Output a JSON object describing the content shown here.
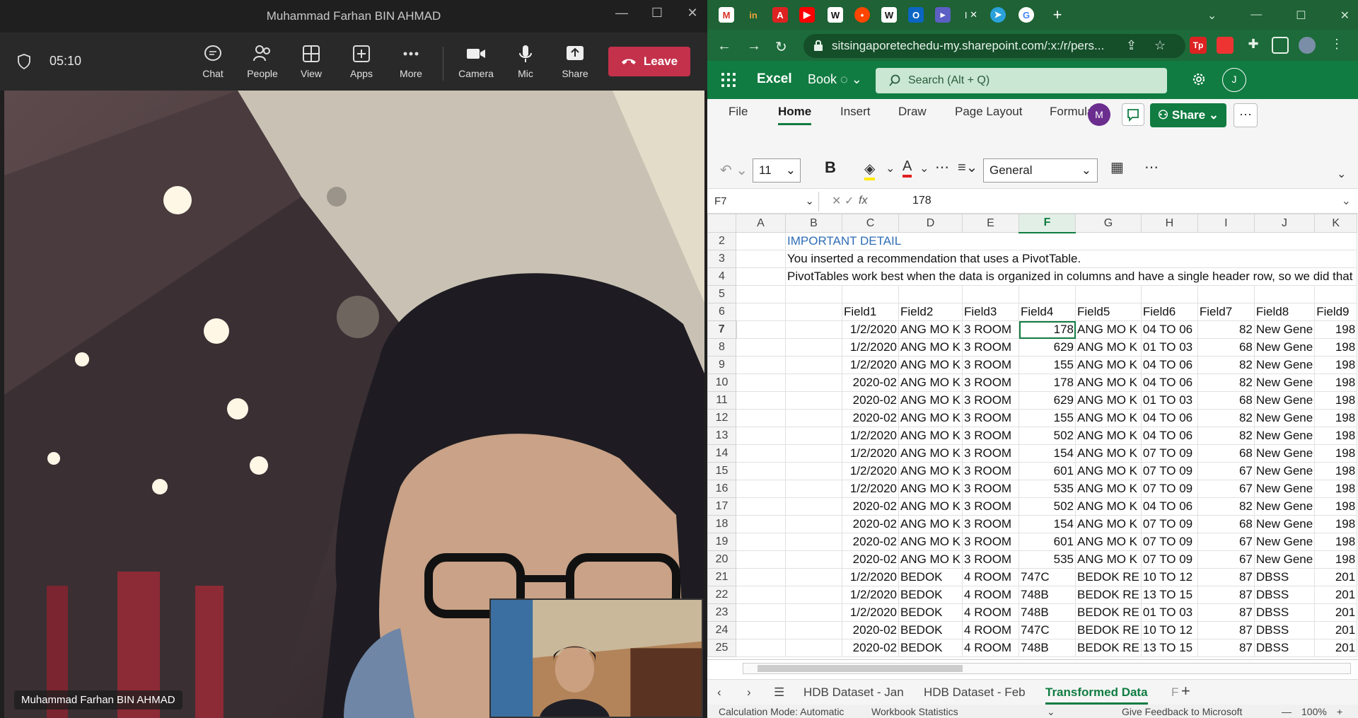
{
  "teams": {
    "title": "Muhammad Farhan BIN AHMAD",
    "timer": "05:10",
    "buttons": [
      "Chat",
      "People",
      "View",
      "Apps",
      "More",
      "Camera",
      "Mic",
      "Share"
    ],
    "leave_label": "Leave",
    "participant_name": "Muhammad Farhan BIN AHMAD",
    "leave_color": "#c4314b"
  },
  "browser": {
    "url": "sitsingaporetechedu-my.sharepoint.com/:x:/r/pers...",
    "active_tab_title": "I",
    "tab_icons": [
      "gmail-icon",
      "in-icon",
      "pdf-icon",
      "youtube-icon",
      "wikipedia-icon",
      "reddit-icon",
      "wikipedia-icon",
      "outlook-icon",
      "app-icon",
      "telegram-icon",
      "google-icon"
    ],
    "accent": "#1e6235"
  },
  "excel": {
    "app_name": "Excel",
    "book_name": "Book",
    "search_placeholder": "Search (Alt + Q)",
    "user_initial": "J",
    "collab_initial": "M",
    "share_label": "Share",
    "ribbon_tabs": [
      "File",
      "Home",
      "Insert",
      "Draw",
      "Page Layout",
      "Formulas"
    ],
    "active_tab": "Home",
    "font_size": "11",
    "number_format": "General",
    "namebox": "F7",
    "formula_value": "178",
    "brand_color": "#107c41",
    "columns": [
      "A",
      "B",
      "C",
      "D",
      "E",
      "F",
      "G",
      "H",
      "I",
      "J",
      "K"
    ],
    "notes": {
      "r2": "IMPORTANT DETAIL",
      "r3": "You inserted a recommendation that uses a PivotTable.",
      "r4": "PivotTables work best when the data is organized in columns and have a single header row, so we did that"
    },
    "headers": [
      "Field1",
      "Field2",
      "Field3",
      "Field4",
      "Field5",
      "Field6",
      "Field7",
      "Field8",
      "Field9"
    ],
    "rows": [
      {
        "n": "7",
        "c": [
          "1/2/2020",
          "ANG MO K",
          "3 ROOM",
          "178",
          "ANG MO K",
          "04 TO 06",
          "82",
          "New Gene",
          "198"
        ]
      },
      {
        "n": "8",
        "c": [
          "1/2/2020",
          "ANG MO K",
          "3 ROOM",
          "629",
          "ANG MO K",
          "01 TO 03",
          "68",
          "New Gene",
          "198"
        ]
      },
      {
        "n": "9",
        "c": [
          "1/2/2020",
          "ANG MO K",
          "3 ROOM",
          "155",
          "ANG MO K",
          "04 TO 06",
          "82",
          "New Gene",
          "198"
        ]
      },
      {
        "n": "10",
        "c": [
          "2020-02",
          "ANG MO K",
          "3 ROOM",
          "178",
          "ANG MO K",
          "04 TO 06",
          "82",
          "New Gene",
          "198"
        ]
      },
      {
        "n": "11",
        "c": [
          "2020-02",
          "ANG MO K",
          "3 ROOM",
          "629",
          "ANG MO K",
          "01 TO 03",
          "68",
          "New Gene",
          "198"
        ]
      },
      {
        "n": "12",
        "c": [
          "2020-02",
          "ANG MO K",
          "3 ROOM",
          "155",
          "ANG MO K",
          "04 TO 06",
          "82",
          "New Gene",
          "198"
        ]
      },
      {
        "n": "13",
        "c": [
          "1/2/2020",
          "ANG MO K",
          "3 ROOM",
          "502",
          "ANG MO K",
          "04 TO 06",
          "82",
          "New Gene",
          "198"
        ]
      },
      {
        "n": "14",
        "c": [
          "1/2/2020",
          "ANG MO K",
          "3 ROOM",
          "154",
          "ANG MO K",
          "07 TO 09",
          "68",
          "New Gene",
          "198"
        ]
      },
      {
        "n": "15",
        "c": [
          "1/2/2020",
          "ANG MO K",
          "3 ROOM",
          "601",
          "ANG MO K",
          "07 TO 09",
          "67",
          "New Gene",
          "198"
        ]
      },
      {
        "n": "16",
        "c": [
          "1/2/2020",
          "ANG MO K",
          "3 ROOM",
          "535",
          "ANG MO K",
          "07 TO 09",
          "67",
          "New Gene",
          "198"
        ]
      },
      {
        "n": "17",
        "c": [
          "2020-02",
          "ANG MO K",
          "3 ROOM",
          "502",
          "ANG MO K",
          "04 TO 06",
          "82",
          "New Gene",
          "198"
        ]
      },
      {
        "n": "18",
        "c": [
          "2020-02",
          "ANG MO K",
          "3 ROOM",
          "154",
          "ANG MO K",
          "07 TO 09",
          "68",
          "New Gene",
          "198"
        ]
      },
      {
        "n": "19",
        "c": [
          "2020-02",
          "ANG MO K",
          "3 ROOM",
          "601",
          "ANG MO K",
          "07 TO 09",
          "67",
          "New Gene",
          "198"
        ]
      },
      {
        "n": "20",
        "c": [
          "2020-02",
          "ANG MO K",
          "3 ROOM",
          "535",
          "ANG MO K",
          "07 TO 09",
          "67",
          "New Gene",
          "198"
        ]
      },
      {
        "n": "21",
        "c": [
          "1/2/2020",
          "BEDOK",
          "4 ROOM",
          "747C",
          "BEDOK RE",
          "10 TO 12",
          "87",
          "DBSS",
          "201"
        ]
      },
      {
        "n": "22",
        "c": [
          "1/2/2020",
          "BEDOK",
          "4 ROOM",
          "748B",
          "BEDOK RE",
          "13 TO 15",
          "87",
          "DBSS",
          "201"
        ]
      },
      {
        "n": "23",
        "c": [
          "1/2/2020",
          "BEDOK",
          "4 ROOM",
          "748B",
          "BEDOK RE",
          "01 TO 03",
          "87",
          "DBSS",
          "201"
        ]
      },
      {
        "n": "24",
        "c": [
          "2020-02",
          "BEDOK",
          "4 ROOM",
          "747C",
          "BEDOK RE",
          "10 TO 12",
          "87",
          "DBSS",
          "201"
        ]
      },
      {
        "n": "25",
        "c": [
          "2020-02",
          "BEDOK",
          "4 ROOM",
          "748B",
          "BEDOK RE",
          "13 TO 15",
          "87",
          "DBSS",
          "201"
        ]
      }
    ],
    "sheet_tabs": [
      "HDB Dataset - Jan",
      "HDB Dataset - Feb",
      "Transformed Data",
      "F"
    ],
    "active_sheet": "Transformed Data",
    "status": {
      "calc_mode": "Calculation Mode: Automatic",
      "workbook_stats": "Workbook Statistics",
      "feedback": "Give Feedback to Microsoft",
      "zoom": "100%"
    }
  }
}
